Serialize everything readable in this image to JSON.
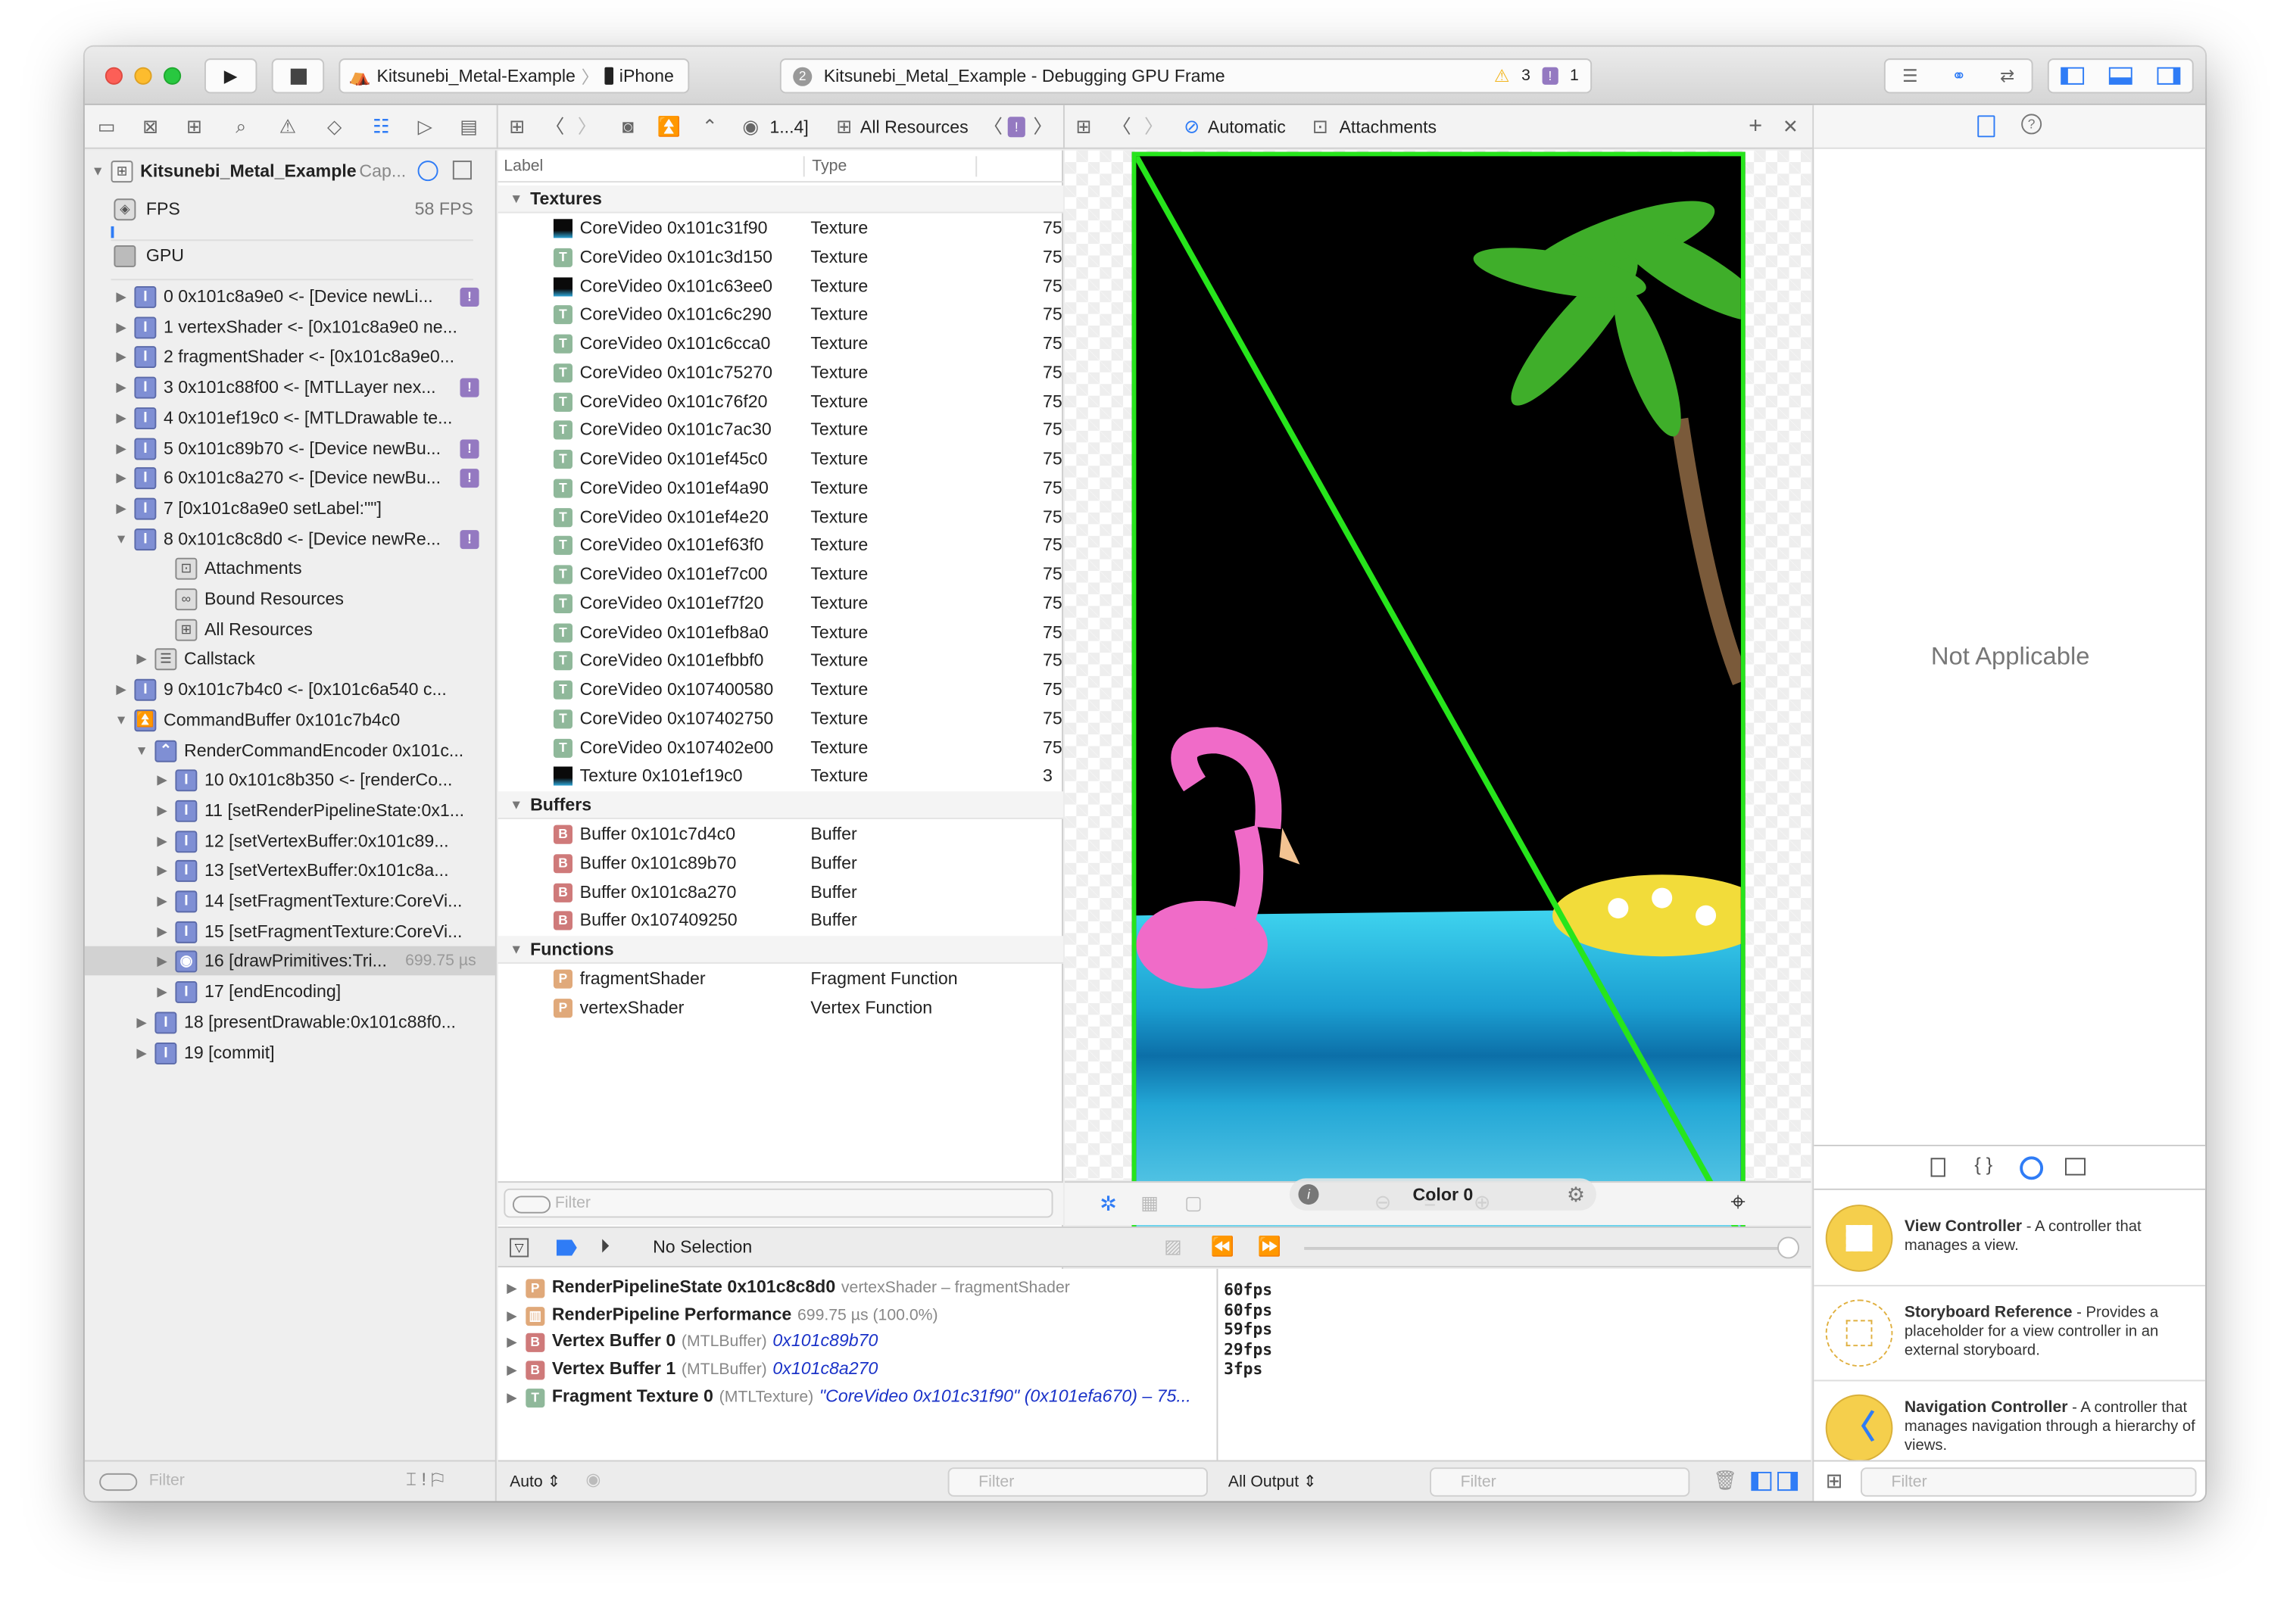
{
  "window": {
    "scheme": "Kitsunebi_Metal-Example",
    "device": "iPhone",
    "activity_count": "2",
    "activity_title": "Kitsunebi_Metal_Example - Debugging GPU Frame",
    "warnings": "3",
    "issues": "1"
  },
  "jump_bar_mid": {
    "crumb_range": "1...4]",
    "current": "All Resources"
  },
  "jump_bar_viewer": {
    "mode": "Automatic",
    "current": "Attachments"
  },
  "navigator": {
    "root_title": "Kitsunebi_Metal_Example",
    "root_suffix": "Cap...",
    "fps_label": "FPS",
    "fps_value": "58 FPS",
    "gpu_label": "GPU",
    "items": [
      {
        "indent": 0,
        "disc": "closed",
        "icon": "call",
        "text": "0 0x101c8a9e0 <- [Device newLi...",
        "badge": "!"
      },
      {
        "indent": 0,
        "disc": "closed",
        "icon": "call",
        "text": "1 vertexShader <- [0x101c8a9e0 ne..."
      },
      {
        "indent": 0,
        "disc": "closed",
        "icon": "call",
        "text": "2 fragmentShader <- [0x101c8a9e0..."
      },
      {
        "indent": 0,
        "disc": "closed",
        "icon": "call",
        "text": "3 0x101c88f00 <- [MTLLayer nex...",
        "badge": "!"
      },
      {
        "indent": 0,
        "disc": "closed",
        "icon": "call",
        "text": "4 0x101ef19c0 <- [MTLDrawable te..."
      },
      {
        "indent": 0,
        "disc": "closed",
        "icon": "call",
        "text": "5 0x101c89b70 <- [Device newBu...",
        "badge": "!"
      },
      {
        "indent": 0,
        "disc": "closed",
        "icon": "call",
        "text": "6 0x101c8a270 <- [Device newBu...",
        "badge": "!"
      },
      {
        "indent": 0,
        "disc": "closed",
        "icon": "call",
        "text": "7 [0x101c8a9e0 setLabel:\"\"]"
      },
      {
        "indent": 0,
        "disc": "open",
        "icon": "call",
        "text": "8 0x101c8c8d0 <- [Device newRe...",
        "badge": "!"
      },
      {
        "indent": 2,
        "disc": "none",
        "icon": "attachments",
        "text": "Attachments"
      },
      {
        "indent": 2,
        "disc": "none",
        "icon": "bound",
        "text": "Bound Resources"
      },
      {
        "indent": 2,
        "disc": "none",
        "icon": "allres",
        "text": "All Resources"
      },
      {
        "indent": 1,
        "disc": "closed",
        "icon": "callstack",
        "text": "Callstack"
      },
      {
        "indent": 0,
        "disc": "closed",
        "icon": "call",
        "text": "9 0x101c7b4c0 <- [0x101c6a540 c..."
      },
      {
        "indent": 0,
        "disc": "open",
        "icon": "cmdbuf",
        "text": "CommandBuffer 0x101c7b4c0"
      },
      {
        "indent": 1,
        "disc": "open",
        "icon": "encoder",
        "text": "RenderCommandEncoder 0x101c..."
      },
      {
        "indent": 2,
        "disc": "closed",
        "icon": "call",
        "text": "10 0x101c8b350 <- [renderCo..."
      },
      {
        "indent": 2,
        "disc": "closed",
        "icon": "call",
        "text": "11 [setRenderPipelineState:0x1..."
      },
      {
        "indent": 2,
        "disc": "closed",
        "icon": "call",
        "text": "12 [setVertexBuffer:0x101c89..."
      },
      {
        "indent": 2,
        "disc": "closed",
        "icon": "call",
        "text": "13 [setVertexBuffer:0x101c8a..."
      },
      {
        "indent": 2,
        "disc": "closed",
        "icon": "call",
        "text": "14 [setFragmentTexture:CoreVi..."
      },
      {
        "indent": 2,
        "disc": "closed",
        "icon": "call",
        "text": "15 [setFragmentTexture:CoreVi..."
      },
      {
        "indent": 2,
        "disc": "closed",
        "icon": "draw",
        "text": "16 [drawPrimitives:Tri...",
        "time": "699.75 µs",
        "selected": true
      },
      {
        "indent": 2,
        "disc": "closed",
        "icon": "call",
        "text": "17 [endEncoding]"
      },
      {
        "indent": 1,
        "disc": "closed",
        "icon": "call",
        "text": "18 [presentDrawable:0x101c88f0..."
      },
      {
        "indent": 1,
        "disc": "closed",
        "icon": "call",
        "text": "19 [commit]"
      }
    ],
    "filter_placeholder": "Filter"
  },
  "resources": {
    "columns": [
      "Label",
      "Type"
    ],
    "groups": [
      {
        "title": "Textures",
        "rows": [
          {
            "icon": "thumb",
            "label": "CoreVideo 0x101c31f90",
            "type": "Texture",
            "extra": "75"
          },
          {
            "icon": "T",
            "label": "CoreVideo 0x101c3d150",
            "type": "Texture",
            "extra": "75"
          },
          {
            "icon": "thumb",
            "label": "CoreVideo 0x101c63ee0",
            "type": "Texture",
            "extra": "75"
          },
          {
            "icon": "T",
            "label": "CoreVideo 0x101c6c290",
            "type": "Texture",
            "extra": "75"
          },
          {
            "icon": "T",
            "label": "CoreVideo 0x101c6cca0",
            "type": "Texture",
            "extra": "75"
          },
          {
            "icon": "T",
            "label": "CoreVideo 0x101c75270",
            "type": "Texture",
            "extra": "75"
          },
          {
            "icon": "T",
            "label": "CoreVideo 0x101c76f20",
            "type": "Texture",
            "extra": "75"
          },
          {
            "icon": "T",
            "label": "CoreVideo 0x101c7ac30",
            "type": "Texture",
            "extra": "75"
          },
          {
            "icon": "T",
            "label": "CoreVideo 0x101ef45c0",
            "type": "Texture",
            "extra": "75"
          },
          {
            "icon": "T",
            "label": "CoreVideo 0x101ef4a90",
            "type": "Texture",
            "extra": "75"
          },
          {
            "icon": "T",
            "label": "CoreVideo 0x101ef4e20",
            "type": "Texture",
            "extra": "75"
          },
          {
            "icon": "T",
            "label": "CoreVideo 0x101ef63f0",
            "type": "Texture",
            "extra": "75"
          },
          {
            "icon": "T",
            "label": "CoreVideo 0x101ef7c00",
            "type": "Texture",
            "extra": "75"
          },
          {
            "icon": "T",
            "label": "CoreVideo 0x101ef7f20",
            "type": "Texture",
            "extra": "75"
          },
          {
            "icon": "T",
            "label": "CoreVideo 0x101efb8a0",
            "type": "Texture",
            "extra": "75"
          },
          {
            "icon": "T",
            "label": "CoreVideo 0x101efbbf0",
            "type": "Texture",
            "extra": "75"
          },
          {
            "icon": "T",
            "label": "CoreVideo 0x107400580",
            "type": "Texture",
            "extra": "75"
          },
          {
            "icon": "T",
            "label": "CoreVideo 0x107402750",
            "type": "Texture",
            "extra": "75"
          },
          {
            "icon": "T",
            "label": "CoreVideo 0x107402e00",
            "type": "Texture",
            "extra": "75"
          },
          {
            "icon": "thumb",
            "label": "Texture 0x101ef19c0",
            "type": "Texture",
            "extra": "3"
          }
        ]
      },
      {
        "title": "Buffers",
        "rows": [
          {
            "icon": "B",
            "label": "Buffer 0x101c7d4c0",
            "type": "Buffer"
          },
          {
            "icon": "B",
            "label": "Buffer 0x101c89b70",
            "type": "Buffer"
          },
          {
            "icon": "B",
            "label": "Buffer 0x101c8a270",
            "type": "Buffer"
          },
          {
            "icon": "B",
            "label": "Buffer 0x107409250",
            "type": "Buffer"
          }
        ]
      },
      {
        "title": "Functions",
        "rows": [
          {
            "icon": "P",
            "label": "fragmentShader",
            "type": "Fragment Function"
          },
          {
            "icon": "P",
            "label": "vertexShader",
            "type": "Vertex Function"
          }
        ]
      }
    ],
    "filter_placeholder": "Filter"
  },
  "viewer": {
    "overlay_label": "Color 0",
    "attachment_border_color": "#27e51c"
  },
  "debug": {
    "status": "No Selection",
    "variables": [
      {
        "icon": "P",
        "name": "RenderPipelineState 0x101c8c8d0",
        "detail": "vertexShader – fragmentShader",
        "value": ""
      },
      {
        "icon": "perf",
        "name": "RenderPipeline Performance",
        "detail": "699.75 µs (100.0%)",
        "value": ""
      },
      {
        "icon": "B",
        "name": "Vertex Buffer 0",
        "detail": "(MTLBuffer)",
        "value": "0x101c89b70"
      },
      {
        "icon": "B",
        "name": "Vertex Buffer 1",
        "detail": "(MTLBuffer)",
        "value": "0x101c8a270"
      },
      {
        "icon": "T",
        "name": "Fragment Texture 0",
        "detail": "(MTLTexture)",
        "value": "\"CoreVideo 0x101c31f90\" (0x101efa670) – 75..."
      }
    ],
    "console_lines": [
      "60fps",
      "60fps",
      "59fps",
      "29fps",
      "3fps"
    ],
    "auto_label": "Auto ⇕",
    "output_label": "All Output ⇕",
    "filter_placeholder": "Filter"
  },
  "inspector": {
    "empty_text": "Not Applicable",
    "library": [
      {
        "icon": "view-controller",
        "title": "View Controller",
        "desc": " - A controller that manages a view."
      },
      {
        "icon": "storyboard-reference",
        "title": "Storyboard Reference",
        "desc": " - Provides a placeholder for a view controller in an external storyboard."
      },
      {
        "icon": "navigation-controller",
        "title": "Navigation Controller",
        "desc": " - A controller that manages navigation through a hierarchy of views."
      }
    ],
    "filter_placeholder": "Filter"
  },
  "colors": {
    "accent": "#2f7cf6",
    "call_icon": "#7f8fd4",
    "issue_badge": "#9479c1",
    "texture_icon": "#8fb89a",
    "buffer_icon": "#cf7a7a",
    "function_icon": "#e0a97a",
    "library_yellow": "#f5cf4c"
  }
}
